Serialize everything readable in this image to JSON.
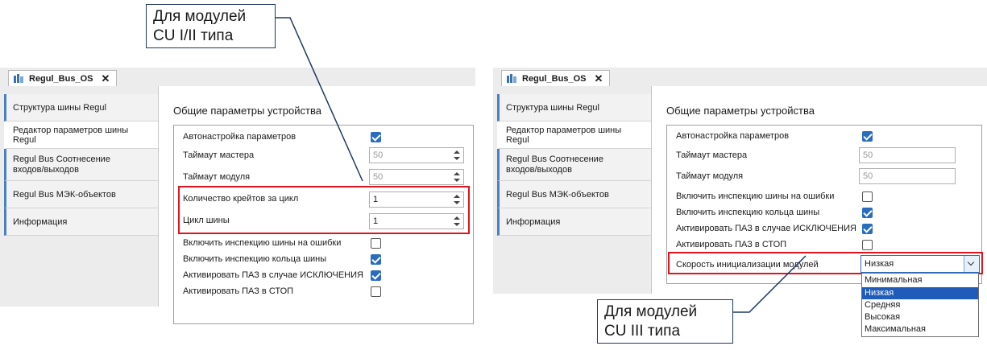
{
  "callouts": {
    "left": {
      "line1": "Для модулей",
      "line2": "CU I/II типа"
    },
    "right": {
      "line1": "Для модулей",
      "line2": "CU III типа"
    }
  },
  "left_window": {
    "tab_title": "Regul_Bus_OS",
    "sidebar": [
      {
        "label": "Структура шины Regul",
        "active": false
      },
      {
        "label": "Редактор параметров шины Regul",
        "active": true
      },
      {
        "label": "Regul Bus Соотнесение\nвходов/выходов",
        "active": false
      },
      {
        "label": "Regul Bus МЭК-объектов",
        "active": false
      },
      {
        "label": "Информация",
        "active": false
      }
    ],
    "section_title": "Общие параметры устройства",
    "rows": {
      "auto_setup": {
        "label": "Автонастройка параметров",
        "checked": true
      },
      "master_timeout": {
        "label": "Таймаут мастера",
        "value": "50"
      },
      "module_timeout": {
        "label": "Таймаут модуля",
        "value": "50"
      },
      "crates_per_cycle": {
        "label": "Количество крейтов за цикл",
        "value": "1"
      },
      "bus_cycle": {
        "label": "Цикл шины",
        "value": "1"
      },
      "bus_error_inspection": {
        "label": "Включить инспекцию шины на ошибки",
        "checked": false
      },
      "ring_inspection": {
        "label": "Включить инспекцию кольца шины",
        "checked": true
      },
      "paz_exception": {
        "label": "Активировать ПАЗ в случае ИСКЛЮЧЕНИЯ",
        "checked": true
      },
      "paz_stop": {
        "label": "Активировать ПАЗ в СТОП",
        "checked": false
      }
    }
  },
  "right_window": {
    "tab_title": "Regul_Bus_OS",
    "sidebar": [
      {
        "label": "Структура шины Regul",
        "active": false
      },
      {
        "label": "Редактор параметров шины Regul",
        "active": true
      },
      {
        "label": "Regul Bus Соотнесение\nвходов/выходов",
        "active": false
      },
      {
        "label": "Regul Bus МЭК-объектов",
        "active": false
      },
      {
        "label": "Информация",
        "active": false
      }
    ],
    "section_title": "Общие параметры устройства",
    "rows": {
      "auto_setup": {
        "label": "Автонастройка параметров",
        "checked": true
      },
      "master_timeout": {
        "label": "Таймаут мастера",
        "value": "50"
      },
      "module_timeout": {
        "label": "Таймаут модуля",
        "value": "50"
      },
      "bus_error_inspection": {
        "label": "Включить инспекцию шины на ошибки",
        "checked": false
      },
      "ring_inspection": {
        "label": "Включить инспекцию кольца шины",
        "checked": true
      },
      "paz_exception": {
        "label": "Активировать ПАЗ в случае ИСКЛЮЧЕНИЯ",
        "checked": true
      },
      "paz_stop": {
        "label": "Активировать ПАЗ в СТОП",
        "checked": false
      },
      "init_speed": {
        "label": "Скорость инициализации модулей",
        "value": "Низкая"
      }
    },
    "init_speed_options": [
      "Минимальная",
      "Низкая",
      "Средняя",
      "Высокая",
      "Максимальная"
    ],
    "init_speed_selected_index": 1
  },
  "colors": {
    "highlight": "#e0141e",
    "accent": "#2a6cc0",
    "callout_border": "#1f3864"
  }
}
